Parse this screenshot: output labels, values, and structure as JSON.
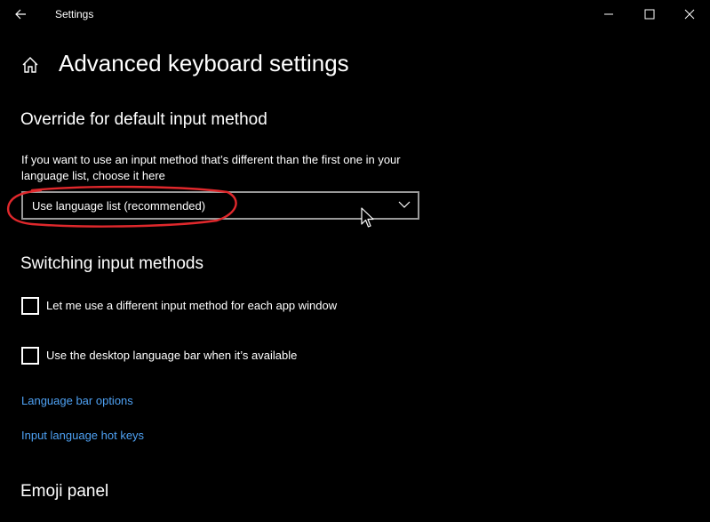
{
  "window": {
    "title": "Settings"
  },
  "page": {
    "title": "Advanced keyboard settings"
  },
  "override_section": {
    "heading": "Override for default input method",
    "description": "If you want to use an input method that’s different than the first one in your language list, choose it here",
    "dropdown_value": "Use language list (recommended)"
  },
  "switching_section": {
    "heading": "Switching input methods",
    "checkboxes": [
      {
        "label": "Let me use a different input method for each app window",
        "checked": false
      },
      {
        "label": "Use the desktop language bar when it’s available",
        "checked": false
      }
    ],
    "links": [
      {
        "label": "Language bar options"
      },
      {
        "label": "Input language hot keys"
      }
    ]
  },
  "emoji_section": {
    "heading": "Emoji panel"
  },
  "colors": {
    "background": "#000000",
    "link": "#4ea1f3",
    "annotation": "#e0282c"
  },
  "icons": [
    "back-arrow-icon",
    "minimize-icon",
    "maximize-icon",
    "close-icon",
    "home-icon",
    "chevron-down-icon",
    "mouse-cursor-icon"
  ]
}
